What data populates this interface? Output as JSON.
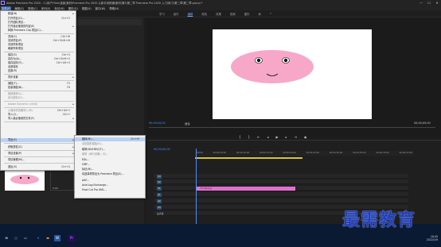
{
  "titlebar": {
    "title": "Adobe Premiere Pro 2020 - C:\\用户\\Yihe\\桌面\\素材\\Premiere Pro 2020 从新手到精通\\素材\\第2\\第二章 Premiere Pro 2020 入门\\练习\\第二章\\第二章.prproj *",
    "minimize": "—",
    "maximize": "☐",
    "close": "✕"
  },
  "menubar": {
    "items": [
      "文件(F)",
      "编辑(E)",
      "剪辑(C)",
      "序列(S)",
      "标记(M)",
      "图形(G)",
      "视图(V)",
      "窗口(W)",
      "帮助(H)"
    ]
  },
  "workspace_tabs": [
    "学习",
    "组件",
    "编辑",
    "颜色",
    "效果",
    "音频",
    "图形",
    "库",
    "»"
  ],
  "file_menu": {
    "items": [
      {
        "label": "新建(N)",
        "shortcut": "",
        "submenu": true,
        "disabled": false
      },
      {
        "label": "打开项目(O)...",
        "shortcut": "Ctrl+O",
        "submenu": false,
        "disabled": false
      },
      {
        "label": "打开团队项目...",
        "shortcut": "",
        "submenu": false,
        "disabled": false
      },
      {
        "label": "打开最近使用的内容(E)",
        "shortcut": "",
        "submenu": true,
        "disabled": false
      },
      {
        "label": "转换 Premiere Clip 项目(C)...",
        "shortcut": "",
        "submenu": false,
        "disabled": false
      },
      {
        "label": "关闭(C)",
        "shortcut": "Ctrl+W",
        "submenu": false,
        "disabled": false
      },
      {
        "label": "关闭项目(P)",
        "shortcut": "Ctrl+Shift+W",
        "submenu": false,
        "disabled": false
      },
      {
        "label": "关闭所有项目",
        "shortcut": "",
        "submenu": false,
        "disabled": false
      },
      {
        "label": "刷新所有项目",
        "shortcut": "",
        "submenu": false,
        "disabled": false
      },
      {
        "label": "保存(S)",
        "shortcut": "Ctrl+S",
        "submenu": false,
        "disabled": false
      },
      {
        "label": "另存为(A)...",
        "shortcut": "Ctrl+Shift+S",
        "submenu": false,
        "disabled": false
      },
      {
        "label": "保存副本(Y)...",
        "shortcut": "Ctrl+Alt+S",
        "submenu": false,
        "disabled": false
      },
      {
        "label": "全部保存",
        "shortcut": "",
        "submenu": false,
        "disabled": false
      },
      {
        "label": "还原(R)",
        "shortcut": "",
        "submenu": false,
        "disabled": false
      },
      {
        "label": "同步设置",
        "shortcut": "",
        "submenu": true,
        "disabled": false
      },
      {
        "label": "捕捉(T)...",
        "shortcut": "F5",
        "submenu": false,
        "disabled": false
      },
      {
        "label": "批量捕捉(B)...",
        "shortcut": "F6",
        "submenu": false,
        "disabled": false
      },
      {
        "label": "链接媒体(L)...",
        "shortcut": "",
        "submenu": false,
        "disabled": true
      },
      {
        "label": "设为脱机(O)...",
        "shortcut": "",
        "submenu": false,
        "disabled": true
      },
      {
        "label": "Adobe Dynamic Link(K)",
        "shortcut": "",
        "submenu": true,
        "disabled": true
      },
      {
        "label": "从媒体浏览器导入(M)",
        "shortcut": "Ctrl+Alt+I",
        "submenu": false,
        "disabled": true
      },
      {
        "label": "导入(I)...",
        "shortcut": "Ctrl+I",
        "submenu": false,
        "disabled": false
      },
      {
        "label": "导入最近使用的文件(F)",
        "shortcut": "",
        "submenu": true,
        "disabled": false
      },
      {
        "label": "导出(E)",
        "shortcut": "",
        "submenu": true,
        "disabled": false,
        "highlighted": true
      },
      {
        "label": "获取属性(G)",
        "shortcut": "",
        "submenu": true,
        "disabled": false
      },
      {
        "label": "项目设置(P)",
        "shortcut": "",
        "submenu": true,
        "disabled": false
      },
      {
        "label": "项目管理(M)...",
        "shortcut": "",
        "submenu": false,
        "disabled": false
      },
      {
        "label": "退出(X)",
        "shortcut": "Ctrl+Q",
        "submenu": false,
        "disabled": false
      }
    ]
  },
  "export_submenu": {
    "items": [
      {
        "label": "媒体(M)...",
        "shortcut": "Ctrl+M",
        "disabled": false,
        "highlighted": true
      },
      {
        "label": "动态图形模板(R)...",
        "shortcut": "",
        "disabled": true
      },
      {
        "label": "磁带(DV/HDV)(T)...",
        "shortcut": "",
        "disabled": false
      },
      {
        "label": "磁带（串行设备）(S)...",
        "shortcut": "",
        "disabled": true
      },
      {
        "label": "EDL...",
        "shortcut": "",
        "disabled": false
      },
      {
        "label": "OMF...",
        "shortcut": "",
        "disabled": false
      },
      {
        "label": "标记(M)...",
        "shortcut": "",
        "disabled": false
      },
      {
        "label": "将选择项导出为 Premiere 项目(S)...",
        "shortcut": "",
        "disabled": false
      },
      {
        "label": "AAF...",
        "shortcut": "",
        "disabled": false
      },
      {
        "label": "Avid Log Exchange...",
        "shortcut": "",
        "disabled": false
      },
      {
        "label": "Final Cut Pro XML...",
        "shortcut": "",
        "disabled": false
      }
    ]
  },
  "program_monitor": {
    "timecode_left": "00;00;00;00",
    "timecode_right": "00;00;05;00",
    "fit_label": "适合"
  },
  "timeline": {
    "timecode": "00;00;00;00",
    "ruler_ticks": [
      "00;00",
      "00;00;05;00",
      "00;00;10;00",
      "00;00;15;00",
      "00;00;20;00",
      "00;00;25;00",
      "00;00;30;00",
      "00;00;35;00",
      "00;00;40;00",
      "00;00;45;00"
    ],
    "tracks": [
      "V3",
      "V2",
      "V1",
      "A1",
      "A2",
      "A3",
      "主声道"
    ],
    "clip_label": "fx Hmong"
  },
  "project_panel": {
    "thumb_duration": "5;00"
  },
  "taskbar": {
    "time": "16:45",
    "date": "2022/1/9"
  },
  "watermark": "最需教育",
  "colors": {
    "accent_blue": "#4f8dff",
    "clip_pink": "#e26fce",
    "menu_highlight": "#b9d2f2",
    "pig_pink": "#f7a8c9"
  }
}
